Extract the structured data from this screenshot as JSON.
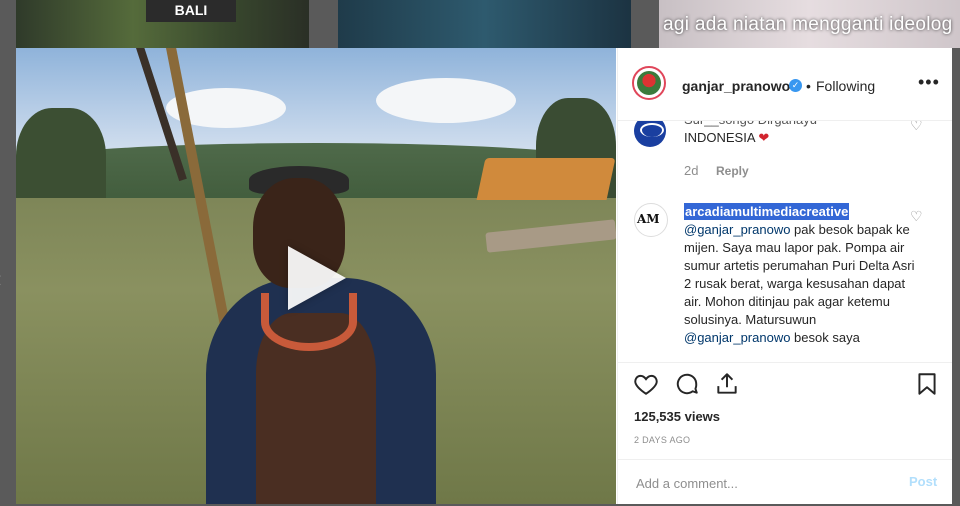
{
  "background": {
    "thumb1_ribbon": "BALI",
    "thumb3_caption": "agi ada niatan mengganti ideolog"
  },
  "post": {
    "username": "ganjar_pranowo",
    "verified_mark": "✓",
    "dot_separator": "•",
    "follow_state": "Following",
    "more_icon": "•••",
    "views": "125,535 views",
    "date": "2 DAYS AGO",
    "add_comment_placeholder": "Add a comment...",
    "post_button": "Post"
  },
  "comments": [
    {
      "partial_line": "Sur__songo Dirgahayu",
      "text": "INDONESIA",
      "emoji": "❤",
      "time": "2d",
      "reply": "Reply"
    },
    {
      "avatar_label": "AM",
      "username": "arcadiamultimediacreative",
      "mention": "@ganjar_pranowo",
      "body": " pak besok bapak ke mijen. Saya mau lapor pak. Pompa air sumur artetis perumahan Puri Delta Asri 2 rusak berat, warga kesusahan dapat air. Mohon ditinjau pak agar ketemu solusinya. Matursuwun ",
      "mention2": "@ganjar_pranowo",
      "body2": " besok saya"
    }
  ],
  "icons": {
    "like": "heart-icon",
    "comment": "comment-icon",
    "share": "share-icon",
    "save": "bookmark-icon",
    "verified": "verified-badge-icon"
  },
  "colors": {
    "accent": "#3897f0",
    "highlight": "#3367d6",
    "text": "#262626",
    "muted": "#8e8e8e",
    "heart": "#d2242e"
  }
}
